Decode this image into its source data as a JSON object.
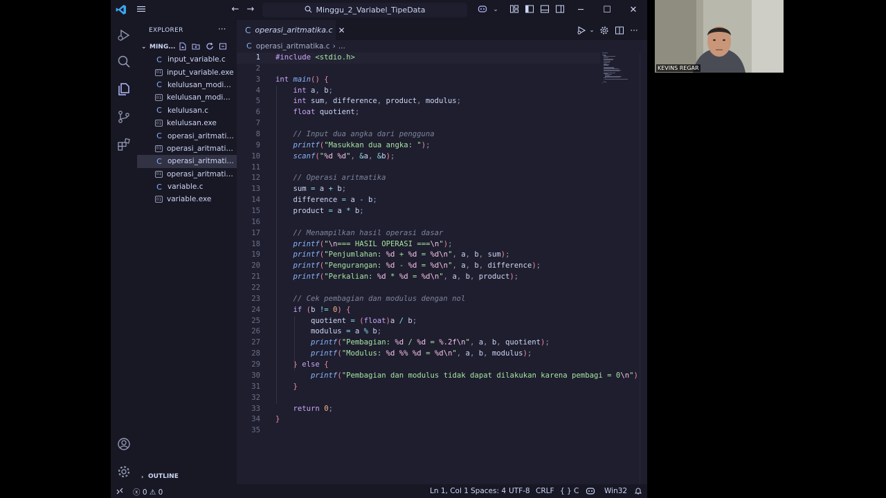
{
  "titlebar": {
    "search_text": "Minggu_2_Variabel_TipeData"
  },
  "sidebar": {
    "title": "EXPLORER",
    "more": "···",
    "folder_name": "MING...",
    "files": [
      {
        "name": "input_variable.c",
        "type": "c"
      },
      {
        "name": "input_variable.exe",
        "type": "exe"
      },
      {
        "name": "kelulusan_modifik...",
        "type": "c"
      },
      {
        "name": "kelulusan_modifik...",
        "type": "exe"
      },
      {
        "name": "kelulusan.c",
        "type": "c"
      },
      {
        "name": "kelulusan.exe",
        "type": "exe"
      },
      {
        "name": "operasi_aritmatika...",
        "type": "c"
      },
      {
        "name": "operasi_aritmatika...",
        "type": "exe"
      },
      {
        "name": "operasi_aritmatika.c",
        "type": "c",
        "active": true
      },
      {
        "name": "operasi_aritmatika....",
        "type": "exe"
      },
      {
        "name": "variable.c",
        "type": "c"
      },
      {
        "name": "variable.exe",
        "type": "exe"
      }
    ],
    "outline_label": "OUTLINE"
  },
  "editor": {
    "tab_label": "operasi_aritmatika.c",
    "breadcrumb_file": "operasi_aritmatika.c",
    "breadcrumb_more": "...",
    "current_line": 1,
    "lines": [
      "#include <stdio.h>",
      "",
      "int main() {",
      "    int a, b;",
      "    int sum, difference, product, modulus;",
      "    float quotient;",
      "",
      "    // Input dua angka dari pengguna",
      "    printf(\"Masukkan dua angka: \");",
      "    scanf(\"%d %d\", &a, &b);",
      "",
      "    // Operasi aritmatika",
      "    sum = a + b;",
      "    difference = a - b;",
      "    product = a * b;",
      "",
      "    // Menampilkan hasil operasi dasar",
      "    printf(\"\\n=== HASIL OPERASI ===\\n\");",
      "    printf(\"Penjumlahan: %d + %d = %d\\n\", a, b, sum);",
      "    printf(\"Pengurangan: %d - %d = %d\\n\", a, b, difference);",
      "    printf(\"Perkalian: %d * %d = %d\\n\", a, b, product);",
      "",
      "    // Cek pembagian dan modulus dengan nol",
      "    if (b != 0) {",
      "        quotient = (float)a / b;",
      "        modulus = a % b;",
      "        printf(\"Pembagian: %d / %d = %.2f\\n\", a, b, quotient);",
      "        printf(\"Modulus: %d %% %d = %d\\n\", a, b, modulus);",
      "    } else {",
      "        printf(\"Pembagian dan modulus tidak dapat dilakukan karena pembagi = 0\\n\")",
      "    }",
      "",
      "    return 0;",
      "}",
      ""
    ]
  },
  "statusbar": {
    "errors": "0",
    "warnings": "0",
    "position": "Ln 1, Col 1",
    "spaces": "Spaces: 4",
    "encoding": "UTF-8",
    "eol": "CRLF",
    "language": "C",
    "language_braces": "{ }",
    "platform": "Win32"
  },
  "webcam": {
    "name_label": "KEVINS REGAR"
  },
  "colors": {
    "editor_bg": "#1e1e2e",
    "chrome_bg": "#181825",
    "accent": "#b4befe",
    "string": "#a6e3a1",
    "keyword": "#cba6f7",
    "function": "#89b4fa"
  }
}
